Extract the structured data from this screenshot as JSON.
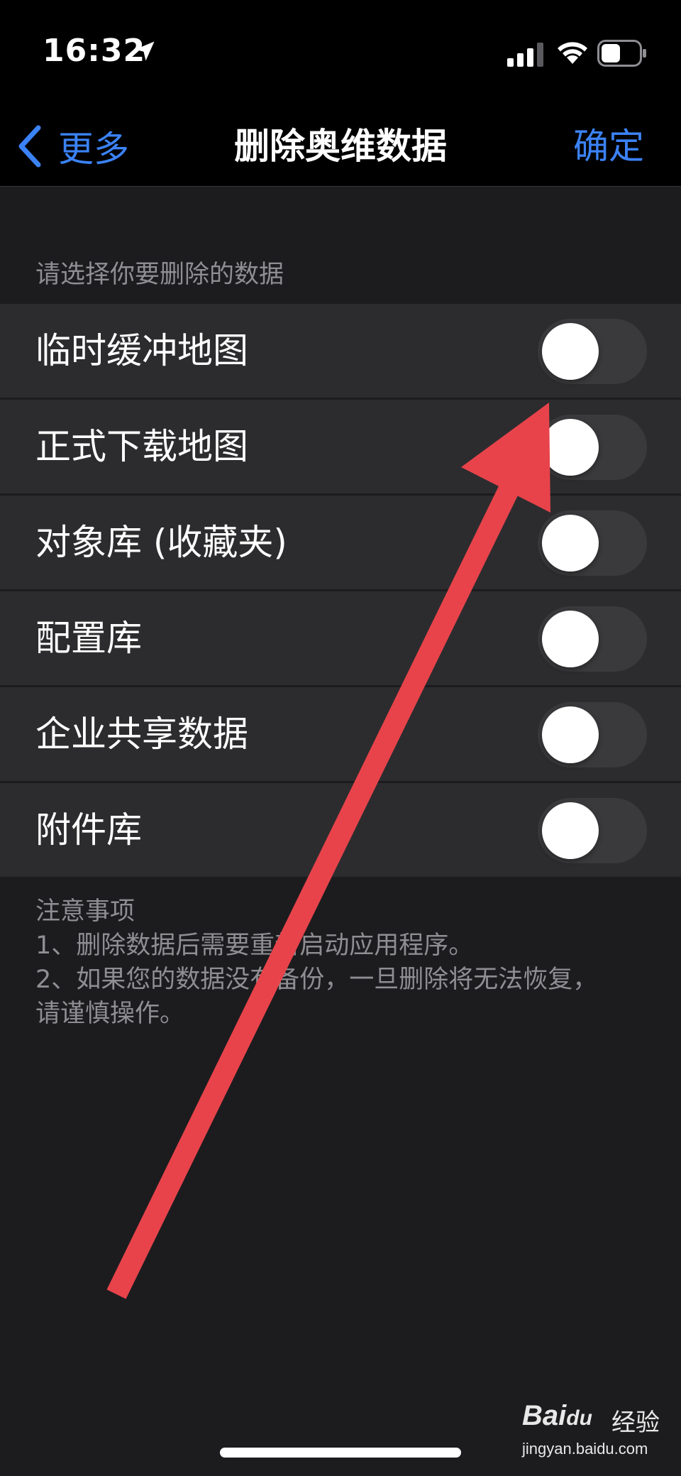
{
  "status_bar": {
    "time": "16:32",
    "icons": [
      "location-arrow-icon",
      "cellular-signal-icon",
      "wifi-icon",
      "battery-icon"
    ]
  },
  "nav": {
    "back_label": "更多",
    "title": "删除奥维数据",
    "confirm_label": "确定"
  },
  "section_header": "请选择你要删除的数据",
  "items": [
    {
      "label": "临时缓冲地图",
      "enabled": false
    },
    {
      "label": "正式下载地图",
      "enabled": false
    },
    {
      "label": "对象库 (收藏夹)",
      "enabled": false
    },
    {
      "label": "配置库",
      "enabled": false
    },
    {
      "label": "企业共享数据",
      "enabled": false
    },
    {
      "label": "附件库",
      "enabled": false
    }
  ],
  "notes": {
    "title": "注意事项",
    "lines": [
      "1、删除数据后需要重新启动应用程序。",
      "2、如果您的数据没有备份，一旦删除将无法恢复，请谨慎操作。"
    ]
  },
  "watermark": {
    "logo": "Bai",
    "logo_du": "du",
    "text": "经验",
    "url": "jingyan.baidu.com"
  },
  "colors": {
    "accent": "#3b82f6",
    "annotation_arrow": "#e8434b",
    "row_background": "#2c2c2e",
    "toggle_off": "#3a3a3c"
  }
}
